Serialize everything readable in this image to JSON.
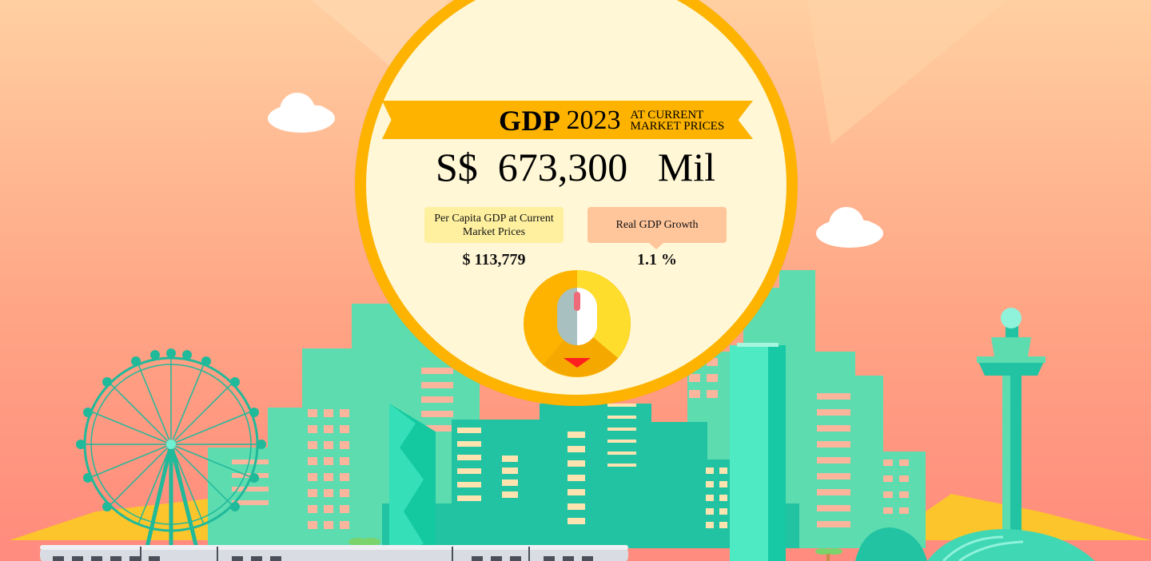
{
  "hero": {
    "ribbon": {
      "title": "GDP",
      "year": "2023",
      "note_line1": "At current",
      "note_line2": "market prices"
    },
    "headline_value": "S$  673,300   Mil",
    "stats": {
      "per_capita": {
        "label": "Per Capita GDP at Current Market Prices",
        "value": "$ 113,779"
      },
      "growth": {
        "label": "Real GDP Growth",
        "value": "1.1 %"
      }
    }
  },
  "scroll_button": {
    "icon": "mouse-scroll-icon",
    "arrow": "arrow-down-icon"
  },
  "colors": {
    "sky_top": "#ffcba0",
    "sky_bottom": "#ff8f7e",
    "buildings": "#5ddcb0",
    "buildings_dark": "#22c3a2",
    "windows": "#fcb59d",
    "accent_gold": "#fdb300",
    "circle_fill": "#fff7d6"
  }
}
